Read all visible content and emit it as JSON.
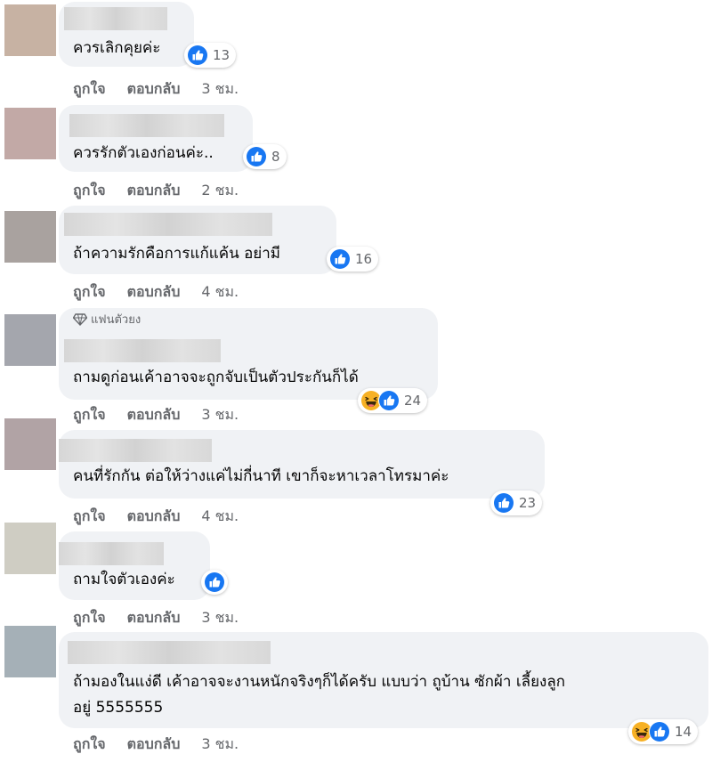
{
  "colors": {
    "like_blue": "#1877f2",
    "haha_yellow": "#f7b125",
    "bubble_bg": "#f0f2f5",
    "meta_gray": "#65676b"
  },
  "actions": {
    "like": "ถูกใจ",
    "reply": "ตอบกลับ"
  },
  "comments": [
    {
      "text": "ควรเลิกคุยค่ะ",
      "reactions": [
        "like-icon"
      ],
      "count": "13",
      "time": "3 ชม.",
      "avatar_color": "#c7b2a3"
    },
    {
      "text": "ควรรักตัวเองก่อนค่ะ..",
      "reactions": [
        "like-icon"
      ],
      "count": "8",
      "time": "2 ชม.",
      "avatar_color": "#c2a9a6"
    },
    {
      "text": "ถ้าความรักคือการแก้แค้น อย่ามี",
      "reactions": [
        "like-icon"
      ],
      "count": "16",
      "time": "4 ชม.",
      "avatar_color": "#a9a29f"
    },
    {
      "badge": "แฟนตัวยง",
      "text": "ถามดูก่อนเค้าอาจจะถูกจับเป็นตัวประกันก็ได้",
      "reactions": [
        "haha-icon",
        "like-icon"
      ],
      "count": "24",
      "time": "3 ชม.",
      "avatar_color": "#a4a6ad"
    },
    {
      "text": "คนที่รักกัน ต่อให้ว่างแค่ไม่กี่นาที เขาก็จะหาเวลาโทรมาค่ะ",
      "reactions": [
        "like-icon"
      ],
      "count": "23",
      "time": "4 ชม.",
      "avatar_color": "#b1a3a5"
    },
    {
      "text": "ถามใจตัวเองค่ะ",
      "reactions": [
        "like-icon"
      ],
      "count": "",
      "time": "3 ชม.",
      "avatar_color": "#cfcdc3"
    },
    {
      "text": "ถ้ามองในแง่ดี เค้าอาจจะงานหนักจริงๆก็ได้ครับ แบบว่า ถูบ้าน ซักผ้า เลี้ยงลูก",
      "text2": "อยู่ 5555555",
      "reactions": [
        "haha-icon",
        "like-icon"
      ],
      "count": "14",
      "time": "3 ชม.",
      "avatar_color": "#a5b0b7"
    }
  ]
}
